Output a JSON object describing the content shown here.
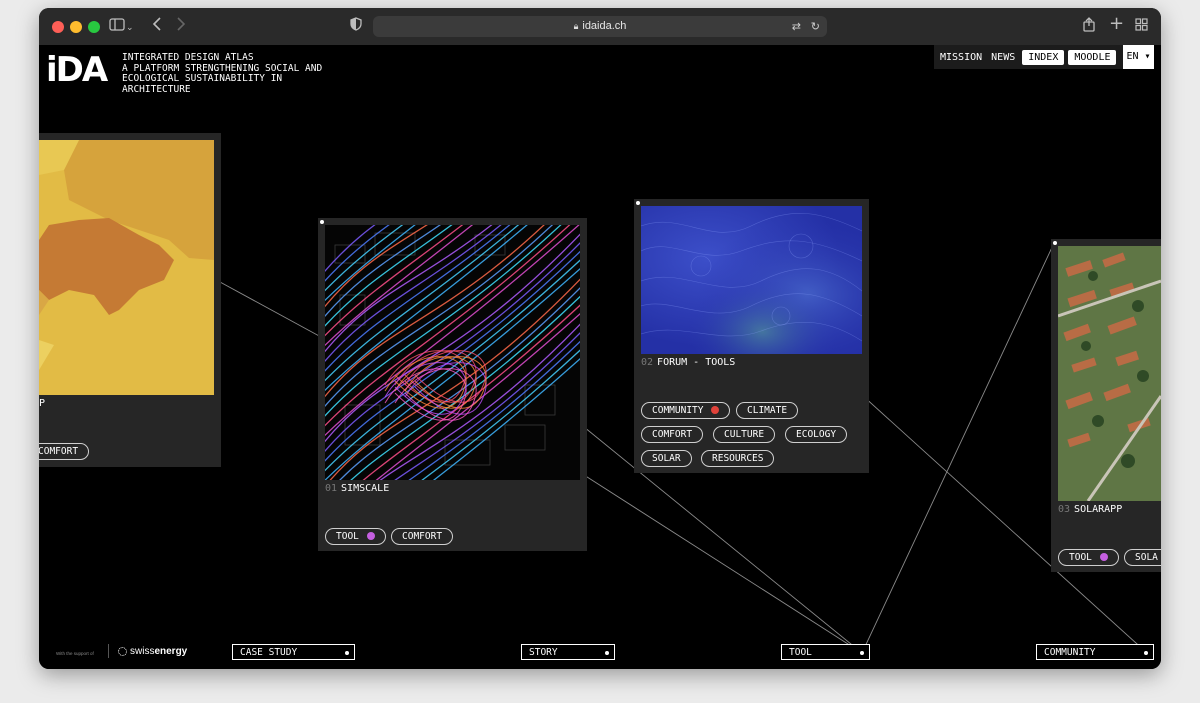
{
  "browser": {
    "url": "idaida.ch"
  },
  "header": {
    "logo": "iDA",
    "tagline": [
      "INTEGRATED DESIGN ATLAS",
      "A PLATFORM STRENGTHENING SOCIAL AND",
      "ECOLOGICAL SUSTAINABILITY IN",
      "ARCHITECTURE"
    ],
    "nav": {
      "mission": "MISSION",
      "news": "NEWS",
      "index": "INDEX",
      "moodle": "MOODLE",
      "lang": "EN ▾"
    }
  },
  "cards": [
    {
      "title_fragment": "P",
      "tags": [
        {
          "label": "COMFORT"
        }
      ],
      "image": "swiss-map"
    },
    {
      "num": "01",
      "title": "SIMSCALE",
      "tags": [
        {
          "label": "TOOL",
          "dot_color": "#c55fe0"
        },
        {
          "label": "COMFORT"
        }
      ],
      "image": "wind-streamlines"
    },
    {
      "num": "02",
      "title": "FORUM - TOOLS",
      "tags": [
        {
          "label": "COMMUNITY",
          "dot_color": "#e0423a"
        },
        {
          "label": "CLIMATE"
        },
        {
          "label": "COMFORT"
        },
        {
          "label": "CULTURE"
        },
        {
          "label": "ECOLOGY"
        },
        {
          "label": "SOLAR"
        },
        {
          "label": "RESOURCES"
        }
      ],
      "image": "flow-field"
    },
    {
      "num": "03",
      "title": "SOLARAPP",
      "tags": [
        {
          "label": "TOOL",
          "dot_color": "#c55fe0"
        },
        {
          "label": "SOLA"
        }
      ],
      "image": "aerial-photo"
    }
  ],
  "filters": [
    "CASE STUDY",
    "STORY",
    "TOOL",
    "COMMUNITY"
  ],
  "footer": {
    "support_text": "With the support of",
    "sponsor_light": "swiss",
    "sponsor_bold": "energy"
  },
  "colors": {
    "background": "#000000",
    "card": "#262626",
    "tool_dot": "#c55fe0",
    "community_dot": "#e0423a"
  }
}
